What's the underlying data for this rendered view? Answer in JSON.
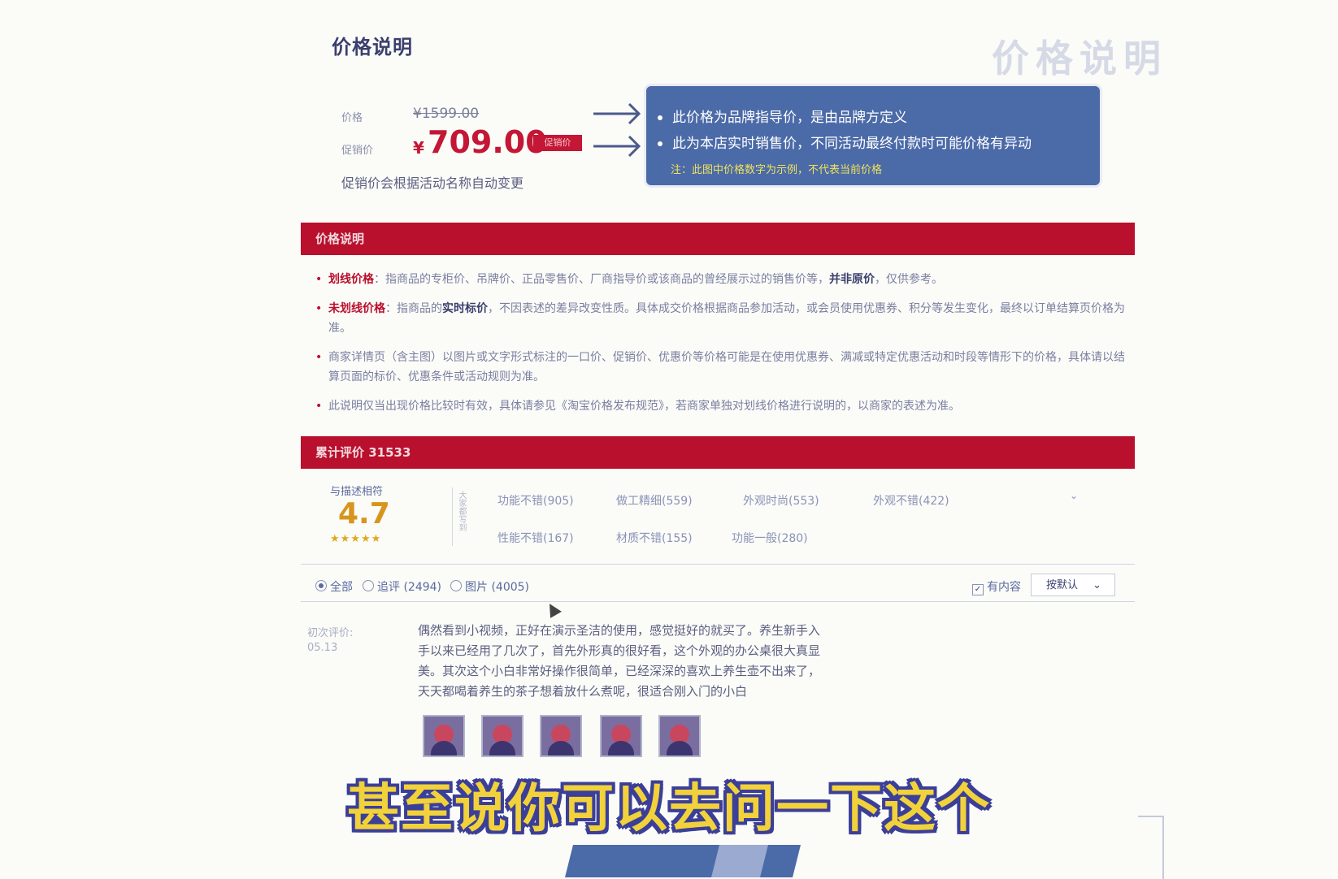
{
  "header": {
    "title": "价格说明",
    "orig_label": "价格",
    "cur_label": "促销价",
    "orig_price": "¥1599.00",
    "cur_symbol": "¥",
    "cur_price": "709.00",
    "price_tag": "促销价",
    "promo_note": "促销价会根据活动名称自动变更"
  },
  "callout": {
    "line1": "此价格为品牌指导价，是由品牌方定义",
    "line2": "此为本店实时销售价，不同活动最终付款时可能价格有异动",
    "note": "注：此图中价格数字为示例，不代表当前价格"
  },
  "deco_text": "价格说明",
  "price_section": {
    "title": "价格说明",
    "b1_label": "划线价格",
    "b1_text": "：指商品的专柜价、吊牌价、正品零售价、厂商指导价或该商品的曾经展示过的销售价等，",
    "b1_emph": "并非原价",
    "b1_tail": "，仅供参考。",
    "b2_label": "未划线价格",
    "b2_text_a": "：指商品的",
    "b2_emph": "实时标价",
    "b2_text_b": "，不因表述的差异改变性质。具体成交价格根据商品参加活动，或会员使用优惠券、积分等发生变化，最终以订单结算页价格为准。",
    "b3_text": "商家详情页（含主图）以图片或文字形式标注的一口价、促销价、优惠价等价格可能是在使用优惠券、满减或特定优惠活动和时段等情形下的价格，具体请以结算页面的标价、优惠条件或活动规则为准。",
    "b4_text": "此说明仅当出现价格比较时有效，具体请参见《淘宝价格发布规范》，若商家单独对划线价格进行说明的，以商家的表述为准。"
  },
  "reviews": {
    "title": "累计评价 31533",
    "score_label": "与描述相符",
    "score": "4.7",
    "stars": "★★★★★",
    "side_label": "大家都写到",
    "tags": [
      "功能不错(905)",
      "做工精细(559)",
      "外观时尚(553)",
      "外观不错(422)",
      "性能不错(167)",
      "材质不错(155)",
      "功能一般(280)"
    ],
    "filters": {
      "all": "全部",
      "append": "追评 (2494)",
      "images": "图片 (4005)",
      "has_content": "有内容",
      "sort": "按默认"
    },
    "item": {
      "meta1": "初次评价:",
      "meta2": "05.13",
      "text": "偶然看到小视频，正好在演示圣洁的使用，感觉挺好的就买了。养生新手入手以来已经用了几次了，首先外形真的很好看，这个外观的办公桌很大真显美。其次这个小白非常好操作很简单，已经深深的喜欢上养生壶不出来了，天天都喝着养生的茶子想着放什么煮呢，很适合刚入门的小白"
    }
  },
  "subtitle": "甚至说你可以去问一下这个"
}
